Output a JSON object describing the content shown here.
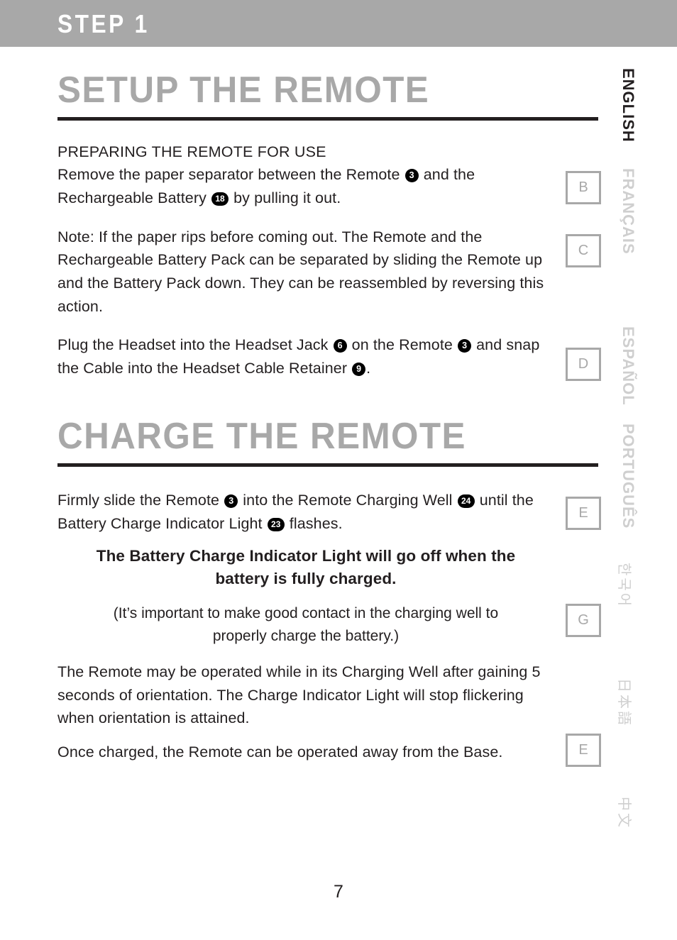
{
  "header": {
    "step_label": "STEP 1"
  },
  "sections": [
    {
      "title": "SETUP THE REMOTE",
      "subhead": "PREPARING THE REMOTE FOR USE",
      "p1_a": "Remove the paper separator between the Remote ",
      "p1_badge1": "3",
      "p1_b": " and the Rechargeable Battery ",
      "p1_badge2": "18",
      "p1_c": " by pulling it out.",
      "p2": "Note: If the paper rips before coming out. The Remote and the Rechargeable Battery Pack can be separated by sliding the Remote up and the Battery Pack down. They can be reassembled by reversing this action.",
      "p3_a": "Plug the Headset into the Headset Jack ",
      "p3_badge1": "6",
      "p3_b": " on the Remote ",
      "p3_badge2": "3",
      "p3_c": " and snap the Cable into the Headset Cable Retainer ",
      "p3_badge3": "9",
      "p3_d": "."
    },
    {
      "title": "CHARGE THE REMOTE",
      "p1_a": "Firmly slide the Remote ",
      "p1_badge1": "3",
      "p1_b": " into the Remote Charging Well ",
      "p1_badge2": "24",
      "p1_c": " until the Battery Charge Indicator Light ",
      "p1_badge3": "23",
      "p1_d": " flashes.",
      "bold_note": "The Battery Charge Indicator Light will go off when the battery is fully charged.",
      "paren_note": "(It’s important to make good contact in the charging well to properly charge the battery.)",
      "p2": "The Remote may be operated while in its Charging Well after gaining 5 seconds of orientation. The Charge Indicator Light will stop flickering when orientation is attained.",
      "p3": "Once charged, the Remote can be operated away from the Base."
    }
  ],
  "rail": {
    "letter_boxes": [
      {
        "label": "B"
      },
      {
        "label": "C"
      },
      {
        "label": "D"
      },
      {
        "label": "E"
      },
      {
        "label": "G"
      },
      {
        "label": "E"
      }
    ],
    "languages": [
      {
        "label": "ENGLISH",
        "active": true
      },
      {
        "label": "FRANÇAIS",
        "active": false
      },
      {
        "label": "ESPAÑOL",
        "active": false
      },
      {
        "label": "PORTUGUÊS",
        "active": false
      },
      {
        "label": "한국어",
        "active": false
      },
      {
        "label": "日本語",
        "active": false
      },
      {
        "label": "中文",
        "active": false
      }
    ]
  },
  "footer": {
    "page_number": "7"
  },
  "colors": {
    "header_gray": "#a8a8a8",
    "heading_gray": "#a8a8a8",
    "rule_black": "#231f20",
    "box_gray": "#a8a8a8",
    "inactive_lang": "#cfcfcf"
  }
}
